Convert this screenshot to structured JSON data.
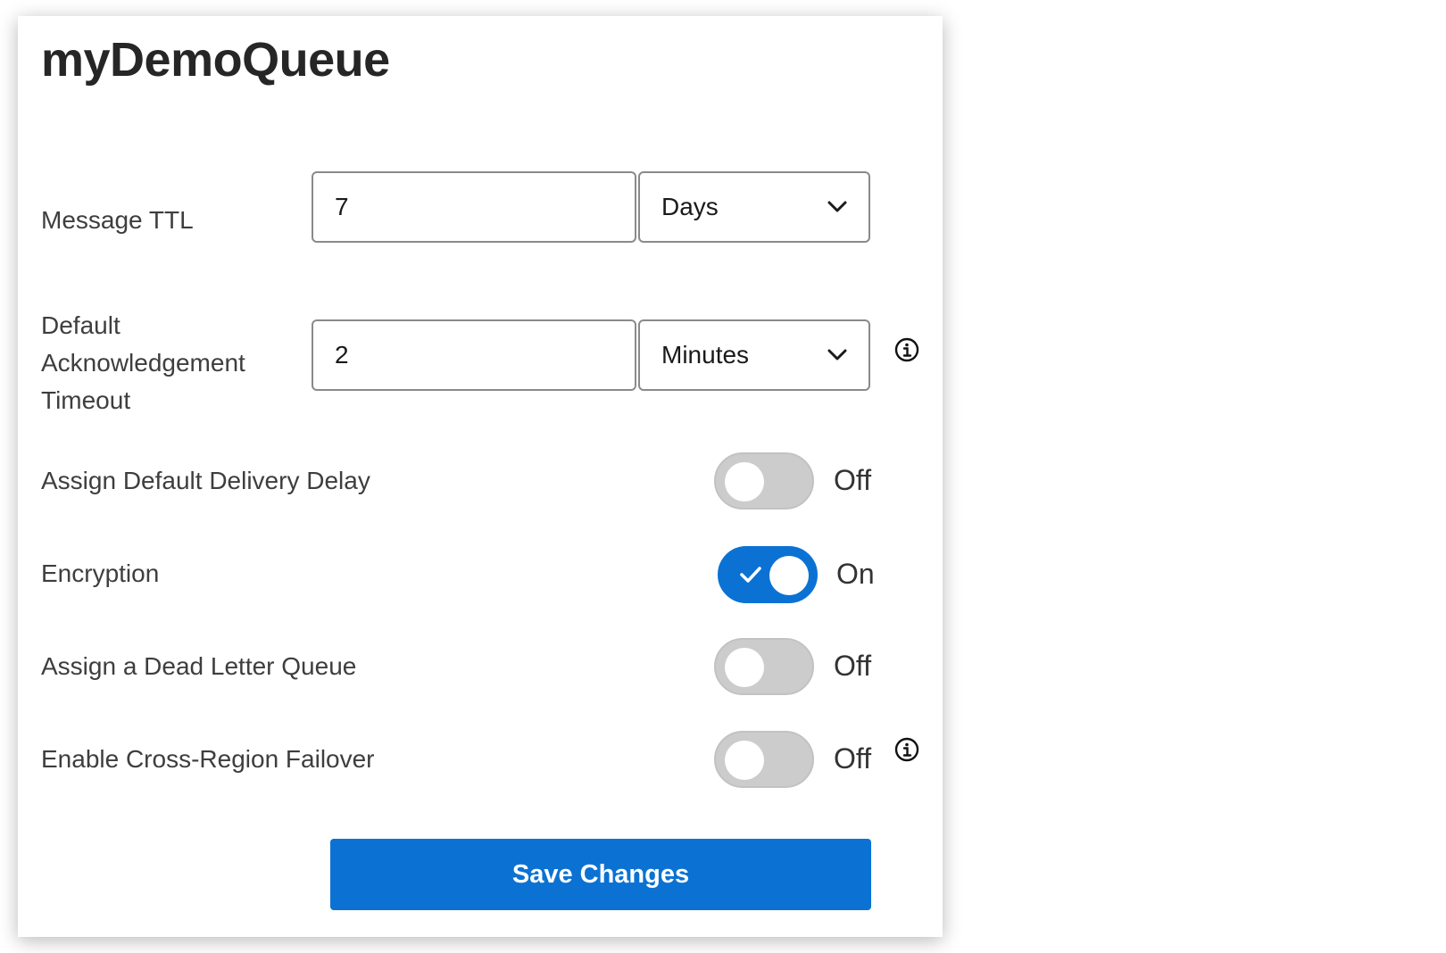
{
  "panel": {
    "title": "myDemoQueue"
  },
  "form": {
    "message_ttl": {
      "label": "Message TTL",
      "value": "7",
      "unit": "Days"
    },
    "ack_timeout": {
      "label_lines": [
        "Default",
        "Acknowledgement",
        "Timeout"
      ],
      "value": "2",
      "unit": "Minutes"
    },
    "toggles": [
      {
        "label": "Assign Default Delivery Delay",
        "state": "Off",
        "on": false
      },
      {
        "label": "Encryption",
        "state": "On",
        "on": true
      },
      {
        "label": "Assign a Dead Letter Queue",
        "state": "Off",
        "on": false
      },
      {
        "label": "Enable Cross-Region Failover",
        "state": "Off",
        "on": false
      }
    ]
  },
  "actions": {
    "save_label": "Save Changes"
  },
  "colors": {
    "accent": "#0b72d4",
    "toggle_off": "#cccccc"
  },
  "icons": {
    "dropdown": "chevron-down-icon",
    "info": "info-icon",
    "toggle_check": "check-icon"
  }
}
